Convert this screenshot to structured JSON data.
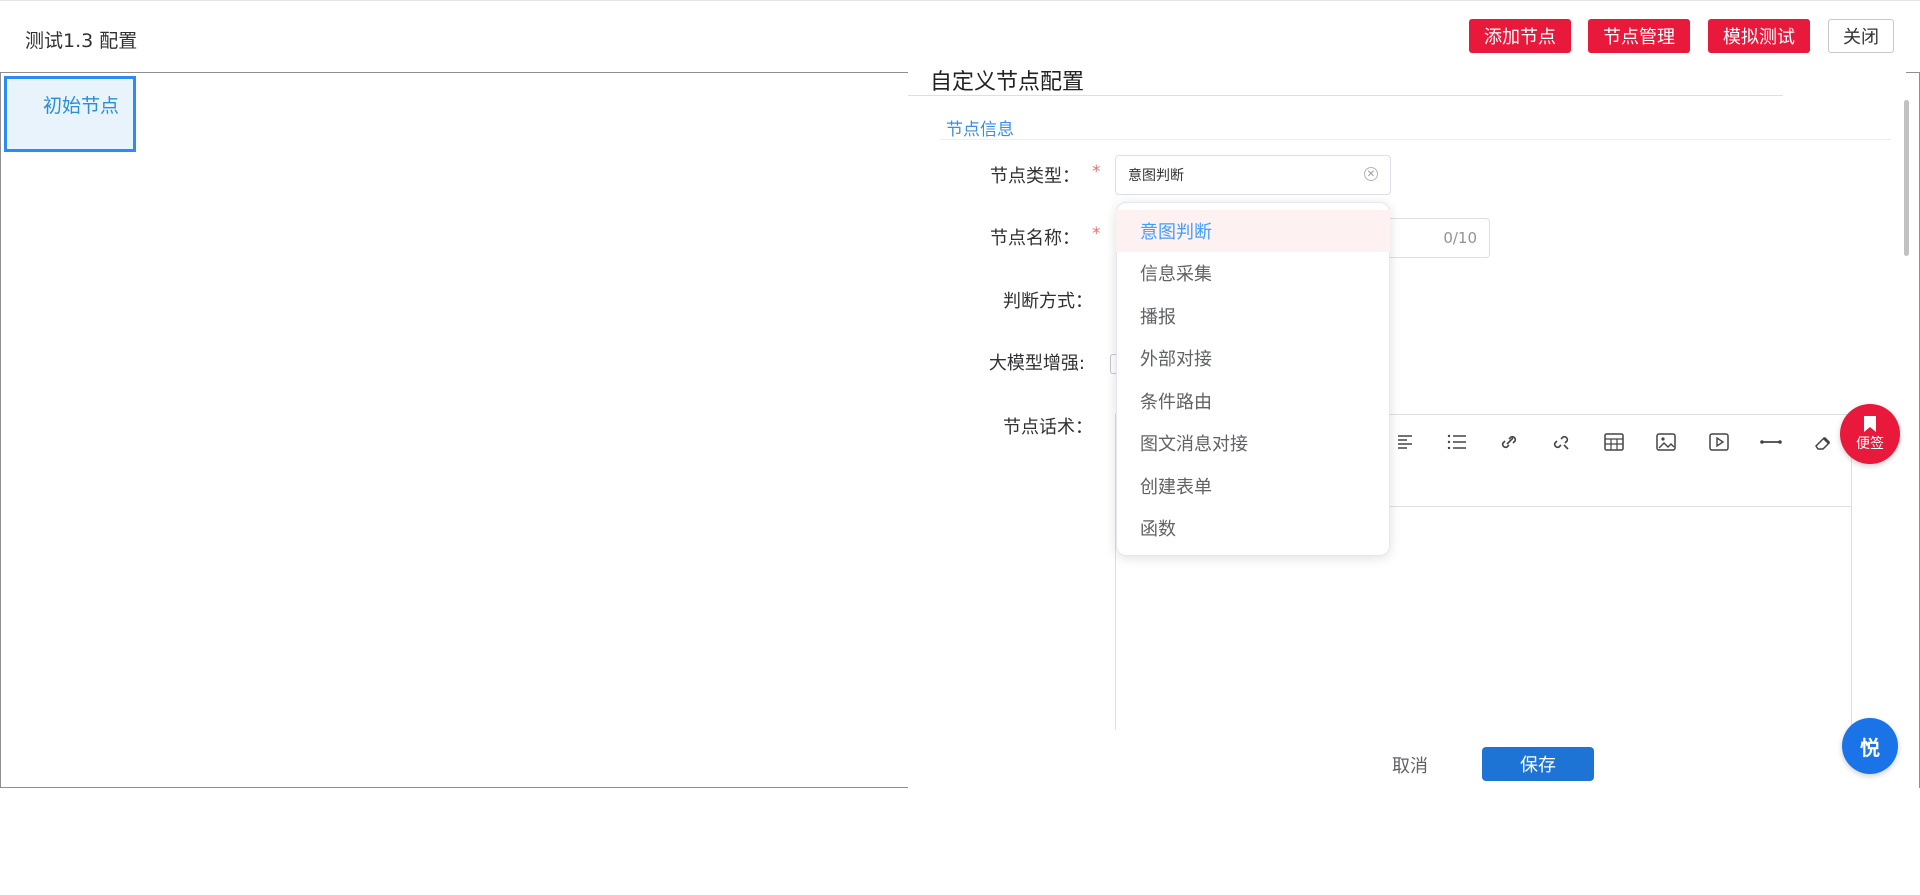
{
  "header": {
    "title": "测试1.3 配置",
    "buttons": {
      "add_node": "添加节点",
      "node_manage": "节点管理",
      "sim_test": "模拟测试",
      "close": "关闭"
    }
  },
  "canvas": {
    "start_node": "初始节点"
  },
  "panel": {
    "title": "自定义节点配置",
    "section": "节点信息",
    "fields": {
      "node_type_label": "节点类型：",
      "node_type_value": "意图判断",
      "node_name_label": "节点名称：",
      "node_name_counter": "0/10",
      "judge_mode_label": "判断方式：",
      "llm_enhance_label": "大模型增强:",
      "node_script_label": "节点话术："
    },
    "required_mark": "*",
    "dropdown_options": [
      "意图判断",
      "信息采集",
      "播报",
      "外部对接",
      "条件路由",
      "图文消息对接",
      "创建表单",
      "函数"
    ],
    "dropdown_selected": "意图判断",
    "toolbar_icons": [
      "align-left-icon",
      "list-icon",
      "link-icon",
      "unlink-icon",
      "table-icon",
      "image-icon",
      "video-icon",
      "divider-icon",
      "eraser-icon"
    ],
    "actions": {
      "cancel": "取消",
      "save": "保存"
    }
  },
  "floating": {
    "note_label": "便签",
    "assistant_label": "悦"
  },
  "colors": {
    "accent_red": "#e8193b",
    "primary_blue": "#1e74d4",
    "link_blue": "#3a8ee6"
  }
}
